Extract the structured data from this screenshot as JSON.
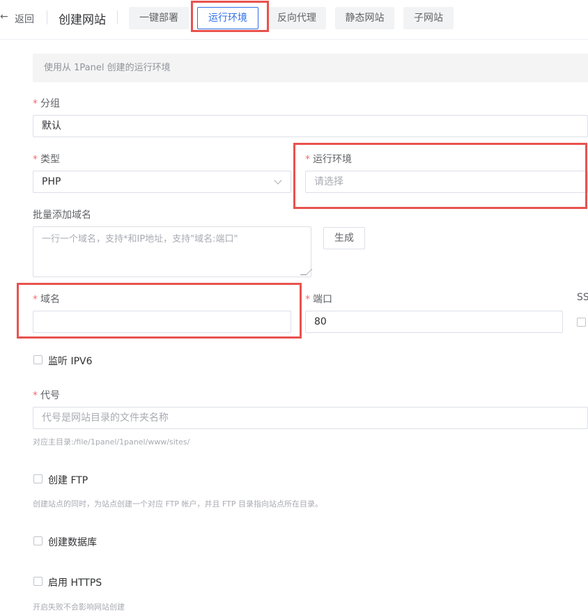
{
  "header": {
    "back_label": "返回",
    "title": "创建网站",
    "tabs": [
      {
        "label": "一键部署"
      },
      {
        "label": "运行环境"
      },
      {
        "label": "反向代理"
      },
      {
        "label": "静态网站"
      },
      {
        "label": "子网站"
      }
    ],
    "active_tab": "运行环境"
  },
  "notice": "使用从 1Panel 创建的运行环境",
  "form": {
    "group": {
      "label": "分组",
      "value": "默认"
    },
    "type": {
      "label": "类型",
      "value": "PHP"
    },
    "runtime": {
      "label": "运行环境",
      "placeholder": "请选择"
    },
    "batch_domains": {
      "label": "批量添加域名",
      "placeholder": "一行一个域名，支持*和IP地址，支持\"域名:端口\"",
      "generate_button": "生成"
    },
    "domain": {
      "label": "域名",
      "value": ""
    },
    "port": {
      "label": "端口",
      "value": "80"
    },
    "ssl": {
      "label": "SS"
    },
    "ipv6": {
      "label": "监听 IPV6",
      "checked": false
    },
    "alias": {
      "label": "代号",
      "placeholder": "代号是网站目录的文件夹名称",
      "hint": "对应主目录:/file/1panel/1panel/www/sites/"
    },
    "ftp": {
      "label": "创建 FTP",
      "checked": false,
      "hint": "创建站点的同时，为站点创建一个对应 FTP 帐户，并且 FTP 目录指向站点所在目录。"
    },
    "database": {
      "label": "创建数据库",
      "checked": false
    },
    "https": {
      "label": "启用 HTTPS",
      "checked": false,
      "hint": "开启失败不会影响网站创建"
    }
  },
  "colors": {
    "primary": "#2f6ee8",
    "required": "#f56c6c",
    "highlight": "#e9524e"
  }
}
